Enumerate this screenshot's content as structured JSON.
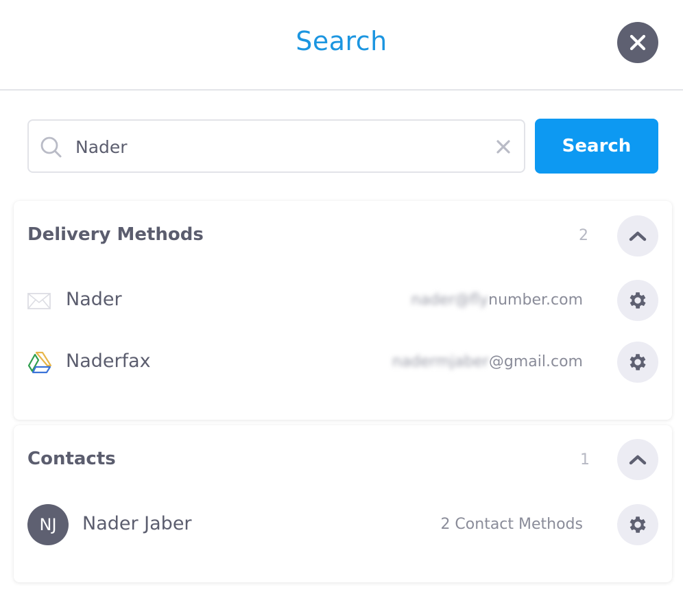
{
  "header": {
    "title": "Search",
    "close_icon": "close-icon"
  },
  "search": {
    "value": "Nader",
    "placeholder": "",
    "search_icon": "search-icon",
    "clear_icon": "clear-icon",
    "button_label": "Search"
  },
  "colors": {
    "accent": "#0d99f2",
    "title": "#1b95e0",
    "dark": "#5e6071",
    "circle_bg": "#ececf3"
  },
  "sections": [
    {
      "title": "Delivery Methods",
      "count": "2",
      "toggle_icon": "chevron-up-icon",
      "items": [
        {
          "icon": "email-icon",
          "name": "Nader",
          "detail_hidden": "nader@fly",
          "detail_visible": "number.com",
          "action_icon": "gear-icon"
        },
        {
          "icon": "google-drive-icon",
          "name": "Naderfax",
          "detail_hidden": "nadermjaber",
          "detail_visible": "@gmail.com",
          "action_icon": "gear-icon"
        }
      ]
    },
    {
      "title": "Contacts",
      "count": "1",
      "toggle_icon": "chevron-up-icon",
      "items": [
        {
          "avatar_initials": "NJ",
          "name": "Nader Jaber",
          "detail": "2 Contact Methods",
          "action_icon": "gear-icon"
        }
      ]
    }
  ]
}
